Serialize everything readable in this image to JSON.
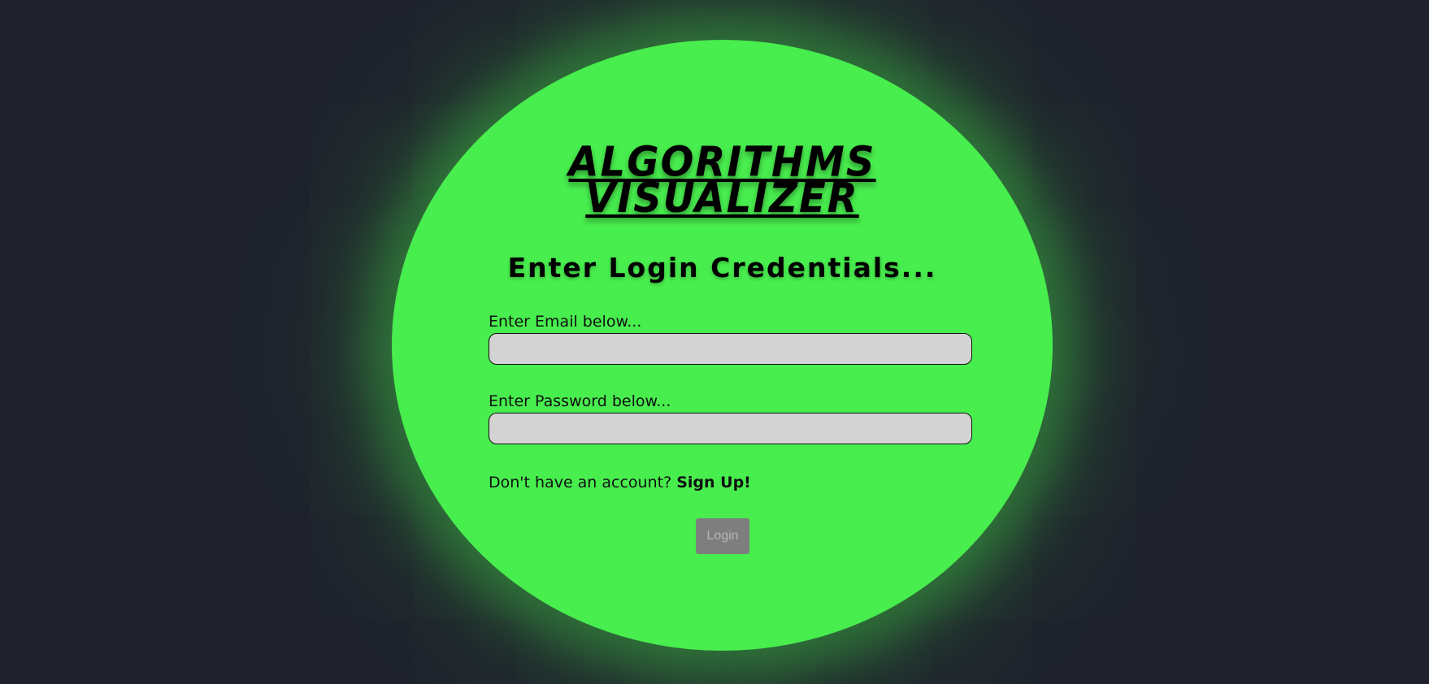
{
  "header": {
    "title_line1": "ALGORITHMS",
    "title_line2": "VISUALIZER",
    "subtitle": "Enter Login Credentials..."
  },
  "form": {
    "email_label": "Enter Email below...",
    "email_value": "",
    "password_label": "Enter Password below...",
    "password_value": "",
    "signup_prompt": "Don't have an account?",
    "signup_link": "Sign Up!",
    "login_label": "Login"
  },
  "colors": {
    "background": "#1f222d",
    "circle": "#48ed4e",
    "input_bg": "#d3d3d3",
    "button_bg": "#7e7e7e",
    "button_text": "#b5b5b5"
  }
}
